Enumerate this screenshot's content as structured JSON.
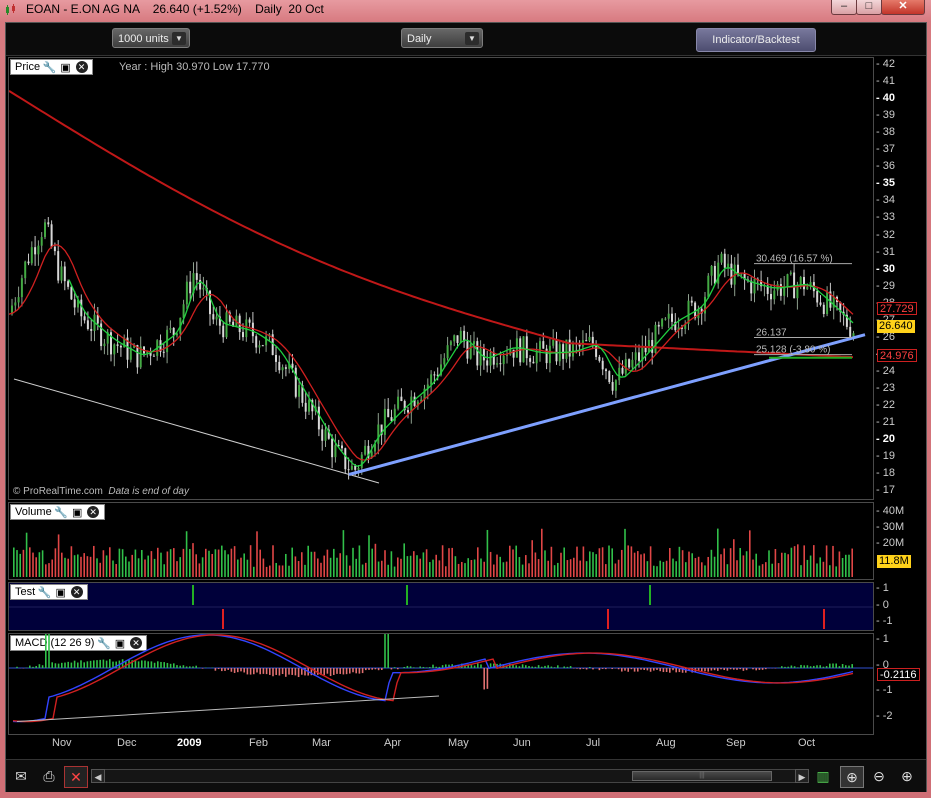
{
  "window": {
    "title": "EOAN - E.ON AG NA    26.640 (+1.52%)    Daily  20 Oct"
  },
  "toolbar": {
    "units": "1000 units",
    "period": "Daily",
    "indicator_button": "Indicator/Backtest"
  },
  "price_panel": {
    "label": "Price",
    "year_range": "Year : High 30.970 Low 17.770",
    "copyright": "© ProRealTime.com",
    "end_note": "Data is end of day",
    "fib_high": "30.469 (16.57 %)",
    "fib_mid": "26.137",
    "fib_low": "25.128 (-3.80 %)",
    "axis_ticks": [
      "42",
      "41",
      "40",
      "39",
      "38",
      "37",
      "36",
      "35",
      "34",
      "33",
      "32",
      "31",
      "30",
      "29",
      "28",
      "27",
      "26",
      "25",
      "24",
      "23",
      "22",
      "21",
      "20",
      "19",
      "18",
      "17"
    ],
    "tag_ma_red": "27.729",
    "tag_last": "26.640",
    "tag_ma_long": "24.976",
    "colors": {
      "short_ma": "#20d040",
      "mid_ma": "#d02020",
      "long_ma": "#c01818",
      "trend": "#7ea0ff",
      "up": "#31c04a",
      "down": "#e04646"
    }
  },
  "volume_panel": {
    "label": "Volume",
    "axis_ticks": [
      "40M",
      "30M",
      "20M"
    ],
    "tag_last": "11.8M"
  },
  "test_panel": {
    "label": "Test",
    "axis_ticks": [
      "1",
      "0",
      "-1"
    ]
  },
  "macd_panel": {
    "label": "MACD (12 26 9)",
    "axis_ticks": [
      "1",
      "0",
      "-1",
      "-2"
    ],
    "tag_last": "-0.2116"
  },
  "x_axis": [
    "Nov",
    "Dec",
    "2009",
    "Feb",
    "Mar",
    "Apr",
    "May",
    "Jun",
    "Jul",
    "Aug",
    "Sep",
    "Oct"
  ],
  "status_icons": [
    "mail-icon",
    "print-icon",
    "disconnect-icon",
    "scroll-left-icon",
    "scroll-right-icon",
    "chart-settings-icon",
    "zoom-fit-icon",
    "zoom-out-icon",
    "zoom-in-icon"
  ]
}
